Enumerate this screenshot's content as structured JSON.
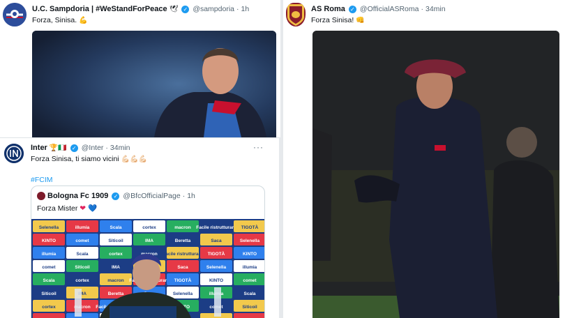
{
  "sampdoria": {
    "name": "U.C. Sampdoria | #WeStandForPeace",
    "flag_icon": "🕊",
    "handle": "@sampdoria",
    "time": "1h",
    "text": "Forza, Sinisa.",
    "emoji": "💪"
  },
  "roma": {
    "name": "AS Roma",
    "handle": "@OfficialASRoma",
    "time": "34min",
    "text": "Forza Sinisa!",
    "emoji": "👊"
  },
  "inter": {
    "name": "Inter",
    "badges": "🏆🇮🇹",
    "handle": "@Inter",
    "time": "34min",
    "more": "···",
    "text": "Forza Sinisa, ti siamo vicini",
    "emoji": "💪🏻💪🏻💪🏻",
    "hashtag": "#FCIM",
    "quote": {
      "name": "Bologna Fc 1909",
      "handle": "@BfcOfficialPage",
      "time": "1h",
      "text": "Forza Mister",
      "heart_red": "❤",
      "heart_blue": "💙"
    }
  },
  "sponsor_board": [
    "Selenella",
    "illumia",
    "Scala",
    "cortex",
    "macron",
    "Facile ristrutturare",
    "TIGOTÀ",
    "KINTO",
    "comet",
    "Siticoil",
    "IMA",
    "Beretta",
    "Saca"
  ],
  "press_chair_logo": "bolognafc.it",
  "colors": {
    "accent": "#1d9bf0",
    "verified": "#1d9bf0",
    "text_secondary": "#536471",
    "border": "#cfd9de"
  },
  "separator": "·"
}
